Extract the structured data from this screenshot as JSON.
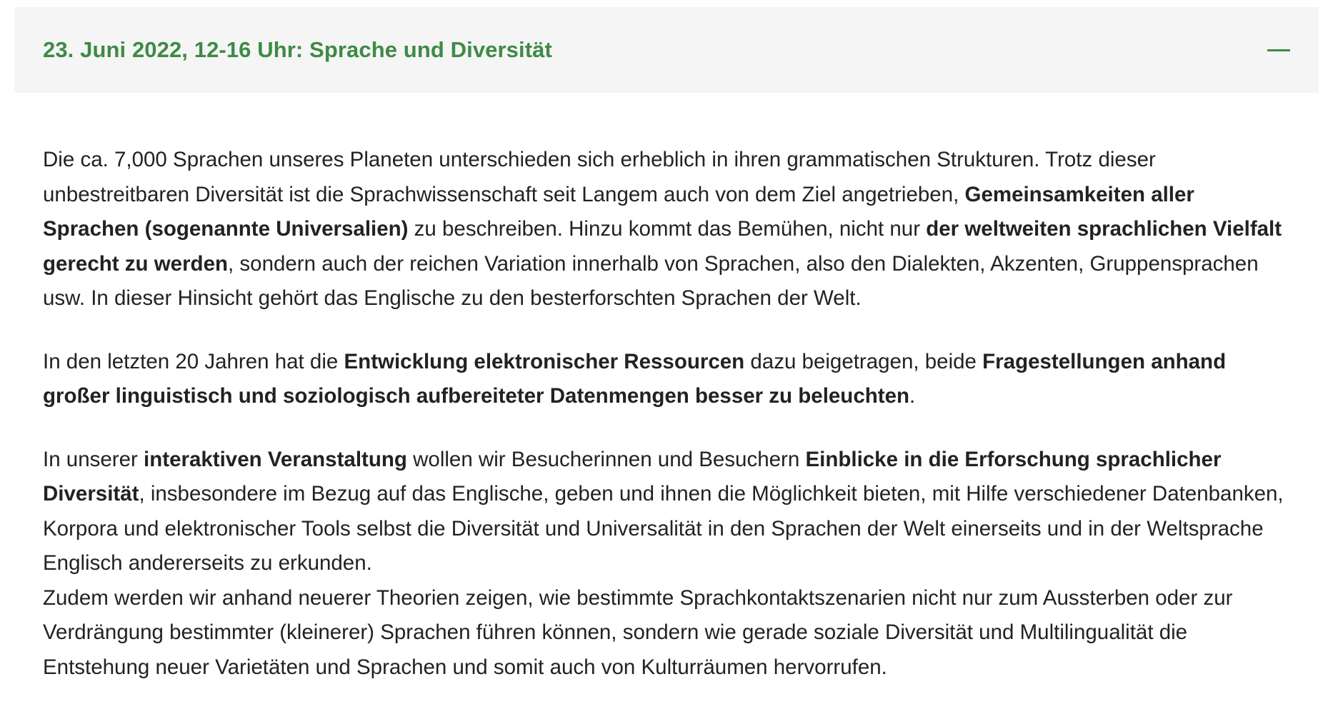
{
  "accordion": {
    "title": "23. Juni 2022, 12-16 Uhr: Sprache und Diversität",
    "icon": "minus-icon",
    "accent_color": "#3e8a46",
    "paragraphs": [
      {
        "segments": [
          {
            "text": "Die ca. 7,000 Sprachen unseres Planeten unterschieden sich erheblich in ihren grammatischen Strukturen. Trotz dieser unbestreitbaren Diversität ist die Sprachwissenschaft seit Langem auch von dem Ziel angetrieben, ",
            "bold": false
          },
          {
            "text": "Gemeinsamkeiten aller Sprachen (sogenannte Universalien)",
            "bold": true
          },
          {
            "text": " zu beschreiben. Hinzu kommt das Bemühen, nicht nur ",
            "bold": false
          },
          {
            "text": "der weltweiten sprachlichen Vielfalt gerecht zu werden",
            "bold": true
          },
          {
            "text": ", sondern auch der reichen Variation innerhalb von Sprachen, also den Dialekten, Akzenten, Gruppensprachen usw. In dieser Hinsicht gehört das Englische zu den besterforschten Sprachen der Welt.",
            "bold": false
          }
        ]
      },
      {
        "segments": [
          {
            "text": "In den letzten 20 Jahren hat die ",
            "bold": false
          },
          {
            "text": "Entwicklung elektronischer Ressourcen",
            "bold": true
          },
          {
            "text": " dazu beigetragen, beide ",
            "bold": false
          },
          {
            "text": "Fragestellungen anhand großer linguistisch und soziologisch aufbereiteter Datenmengen besser zu beleuchten",
            "bold": true
          },
          {
            "text": ".",
            "bold": false
          }
        ]
      },
      {
        "segments": [
          {
            "text": "In unserer ",
            "bold": false
          },
          {
            "text": "interaktiven Veranstaltung",
            "bold": true
          },
          {
            "text": " wollen wir Besucherinnen und Besuchern ",
            "bold": false
          },
          {
            "text": "Einblicke in die Erforschung sprachlicher Diversität",
            "bold": true
          },
          {
            "text": ", insbesondere im Bezug auf das Englische, geben und ihnen die Möglichkeit bieten, mit Hilfe verschiedener Datenbanken, Korpora und elektronischer Tools selbst die Diversität und Universalität in den Sprachen der Welt einerseits und in der Weltsprache Englisch andererseits zu erkunden.",
            "bold": false
          }
        ]
      },
      {
        "segments": [
          {
            "text": "Zudem werden wir anhand neuerer Theorien zeigen, wie bestimmte Sprachkontaktszenarien nicht nur zum Aussterben oder zur Verdrängung bestimmter (kleinerer) Sprachen führen können, sondern wie gerade soziale Diversität und Multilingualität die Entstehung neuer Varietäten und Sprachen und somit auch von Kulturräumen hervorrufen.",
            "bold": false
          }
        ]
      }
    ]
  }
}
